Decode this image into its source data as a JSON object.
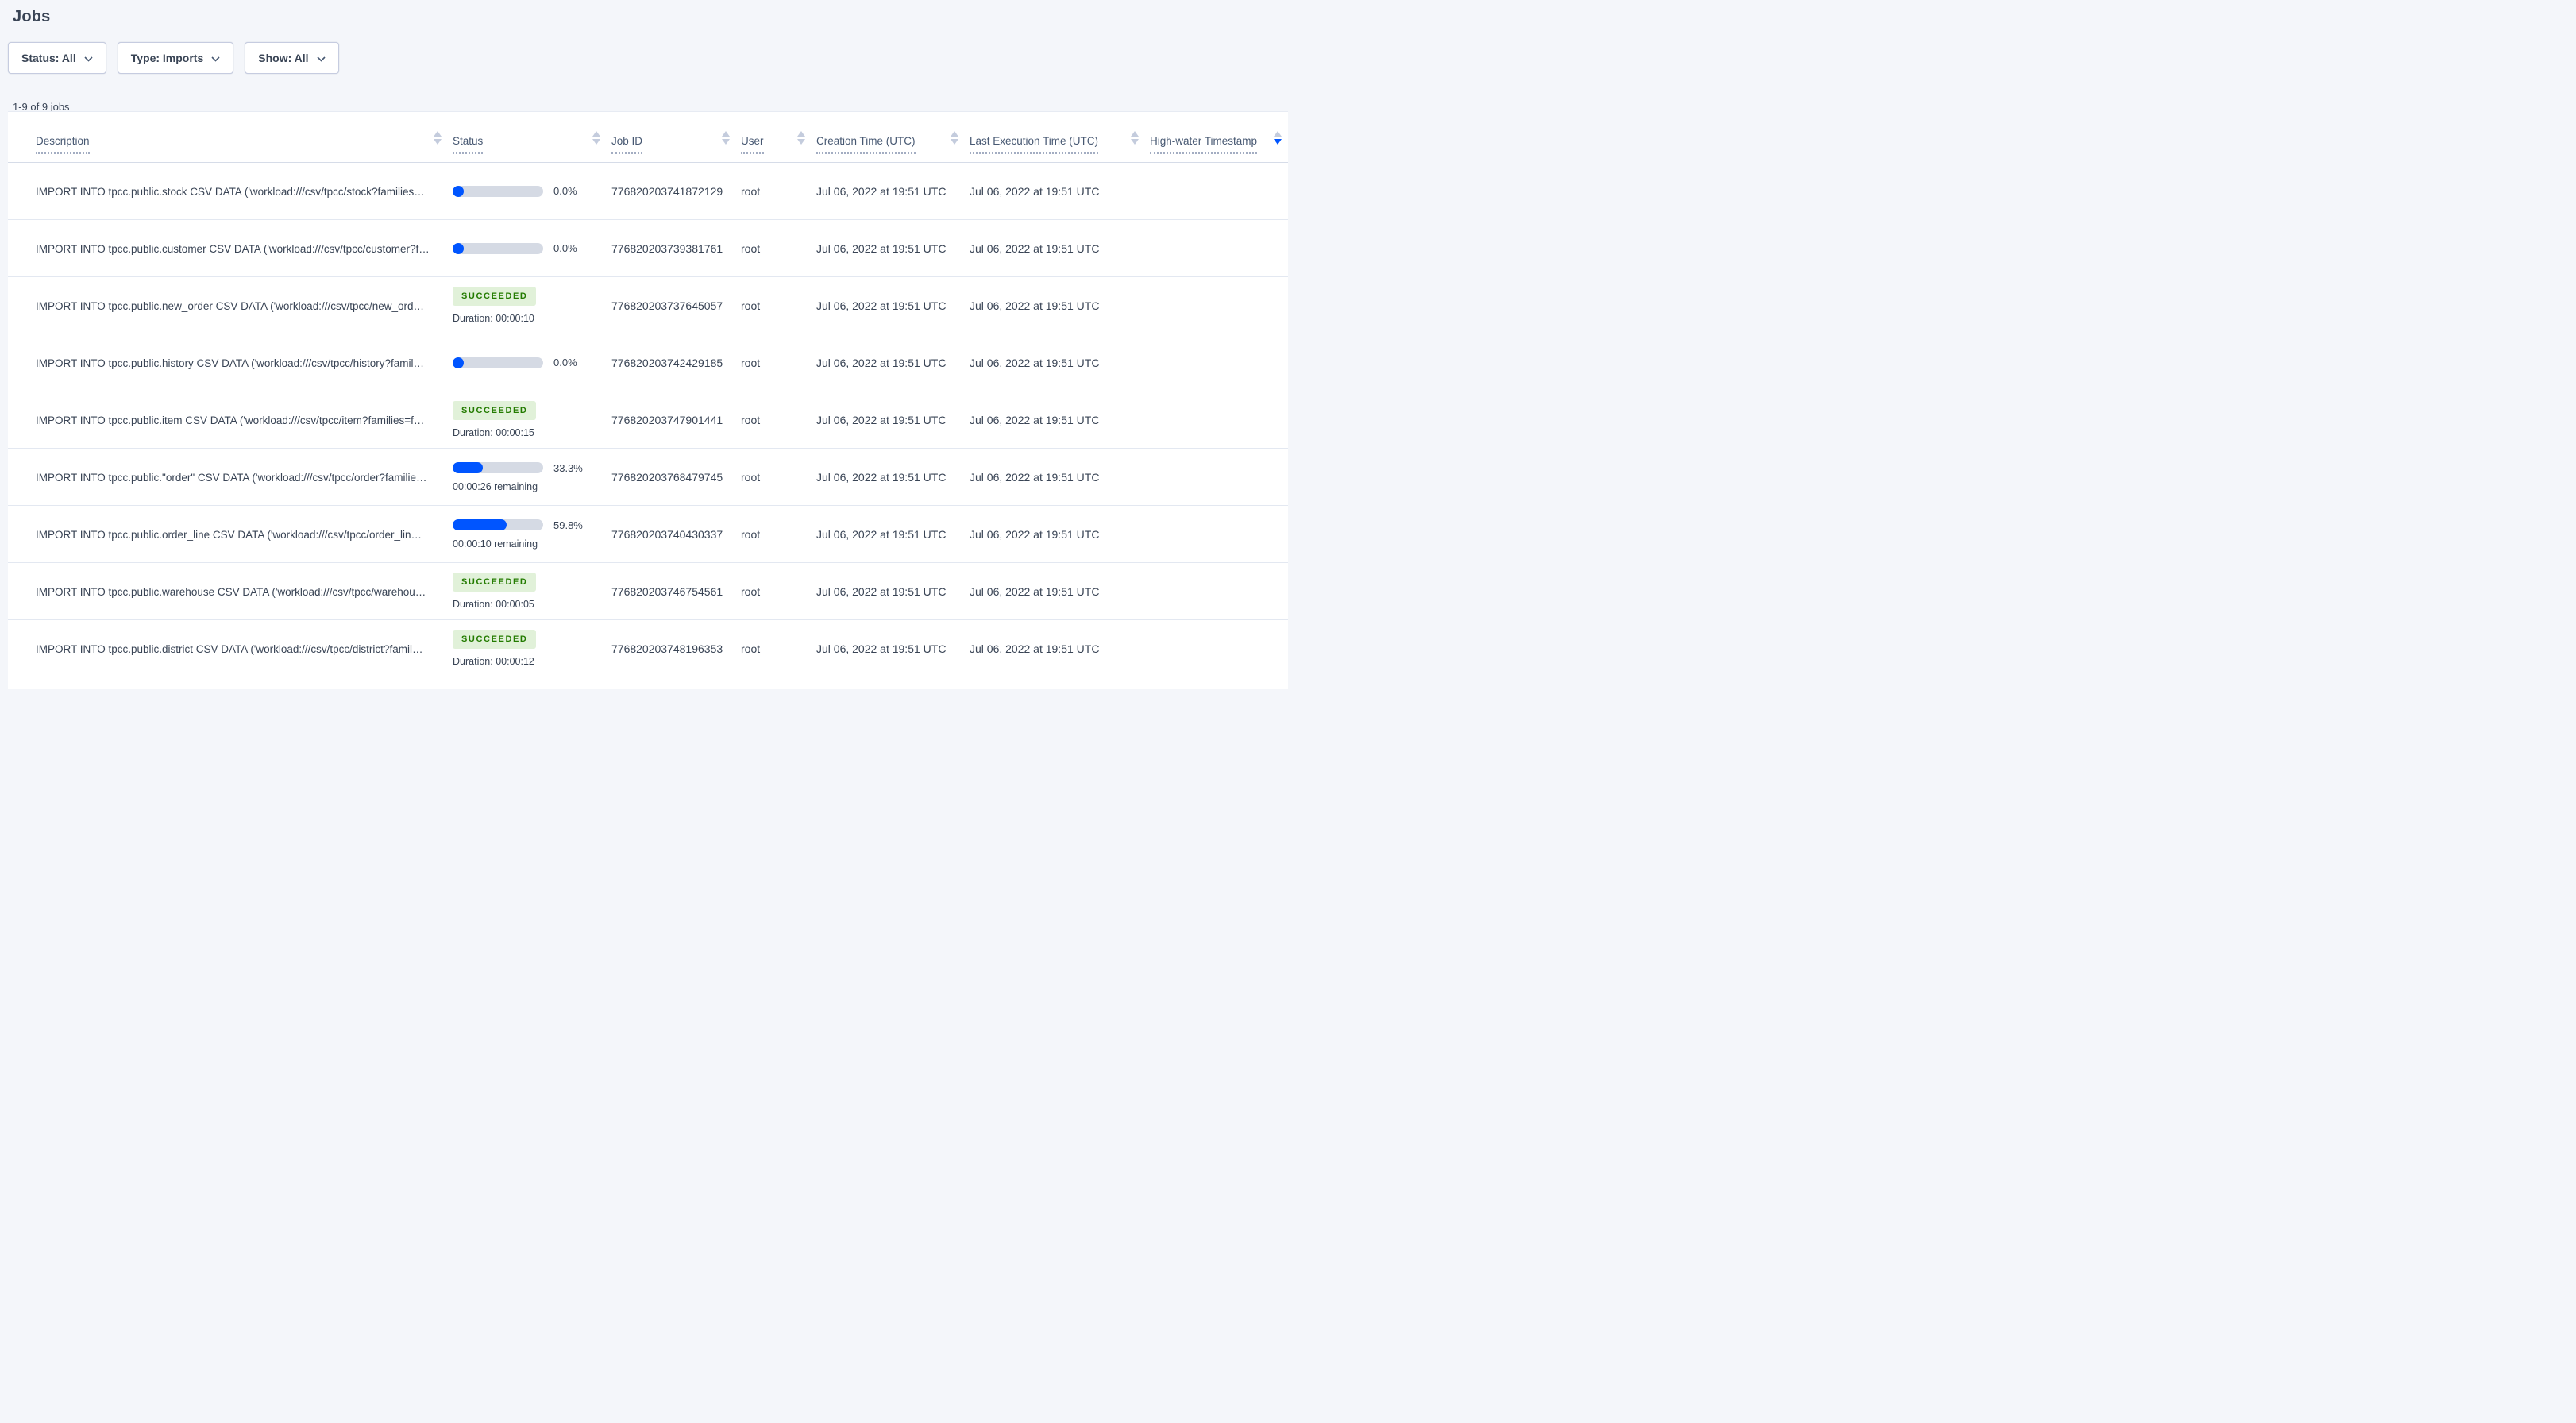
{
  "page": {
    "title": "Jobs",
    "results_count": "1-9 of 9 jobs"
  },
  "filters": [
    {
      "id": "status",
      "label": "Status: All"
    },
    {
      "id": "type",
      "label": "Type: Imports"
    },
    {
      "id": "show",
      "label": "Show: All"
    }
  ],
  "icons": {
    "chevron_down": "chevron-down",
    "sort_arrows": "sort-arrows"
  },
  "colors": {
    "accent_blue": "#0055ff",
    "progress_track": "#d5dae4",
    "badge_green_bg": "#e1f1d9",
    "badge_green_text": "#237b00",
    "page_background": "#f4f6fa",
    "text": "#394455"
  },
  "table": {
    "columns": [
      {
        "label": "Description",
        "sort": "none"
      },
      {
        "label": "Status",
        "sort": "none"
      },
      {
        "label": "Job ID",
        "sort": "none"
      },
      {
        "label": "User",
        "sort": "none"
      },
      {
        "label": "Creation Time (UTC)",
        "sort": "none"
      },
      {
        "label": "Last Execution Time (UTC)",
        "sort": "none"
      },
      {
        "label": "High-water Timestamp",
        "sort": "desc"
      }
    ],
    "rows": [
      {
        "description": "IMPORT INTO tpcc.public.stock CSV DATA ('workload:///csv/tpcc/stock?families…",
        "status": {
          "kind": "progress",
          "percent": "0.0%",
          "fraction": 0,
          "sub": ""
        },
        "job_id": "776820203741872129",
        "user": "root",
        "creation_time": "Jul 06, 2022 at 19:51 UTC",
        "last_execution_time": "Jul 06, 2022 at 19:51 UTC",
        "high_water_timestamp": ""
      },
      {
        "description": "IMPORT INTO tpcc.public.customer CSV DATA ('workload:///csv/tpcc/customer?f…",
        "status": {
          "kind": "progress",
          "percent": "0.0%",
          "fraction": 0,
          "sub": ""
        },
        "job_id": "776820203739381761",
        "user": "root",
        "creation_time": "Jul 06, 2022 at 19:51 UTC",
        "last_execution_time": "Jul 06, 2022 at 19:51 UTC",
        "high_water_timestamp": ""
      },
      {
        "description": "IMPORT INTO tpcc.public.new_order CSV DATA ('workload:///csv/tpcc/new_ord…",
        "status": {
          "kind": "succeeded",
          "label": "SUCCEEDED",
          "sub": "Duration: 00:00:10"
        },
        "job_id": "776820203737645057",
        "user": "root",
        "creation_time": "Jul 06, 2022 at 19:51 UTC",
        "last_execution_time": "Jul 06, 2022 at 19:51 UTC",
        "high_water_timestamp": ""
      },
      {
        "description": "IMPORT INTO tpcc.public.history CSV DATA ('workload:///csv/tpcc/history?famil…",
        "status": {
          "kind": "progress",
          "percent": "0.0%",
          "fraction": 0,
          "sub": ""
        },
        "job_id": "776820203742429185",
        "user": "root",
        "creation_time": "Jul 06, 2022 at 19:51 UTC",
        "last_execution_time": "Jul 06, 2022 at 19:51 UTC",
        "high_water_timestamp": ""
      },
      {
        "description": "IMPORT INTO tpcc.public.item CSV DATA ('workload:///csv/tpcc/item?families=f…",
        "status": {
          "kind": "succeeded",
          "label": "SUCCEEDED",
          "sub": "Duration: 00:00:15"
        },
        "job_id": "776820203747901441",
        "user": "root",
        "creation_time": "Jul 06, 2022 at 19:51 UTC",
        "last_execution_time": "Jul 06, 2022 at 19:51 UTC",
        "high_water_timestamp": ""
      },
      {
        "description": "IMPORT INTO tpcc.public.\"order\" CSV DATA ('workload:///csv/tpcc/order?familie…",
        "status": {
          "kind": "progress",
          "percent": "33.3%",
          "fraction": 0.333,
          "sub": "00:00:26 remaining"
        },
        "job_id": "776820203768479745",
        "user": "root",
        "creation_time": "Jul 06, 2022 at 19:51 UTC",
        "last_execution_time": "Jul 06, 2022 at 19:51 UTC",
        "high_water_timestamp": ""
      },
      {
        "description": "IMPORT INTO tpcc.public.order_line CSV DATA ('workload:///csv/tpcc/order_lin…",
        "status": {
          "kind": "progress",
          "percent": "59.8%",
          "fraction": 0.598,
          "sub": "00:00:10 remaining"
        },
        "job_id": "776820203740430337",
        "user": "root",
        "creation_time": "Jul 06, 2022 at 19:51 UTC",
        "last_execution_time": "Jul 06, 2022 at 19:51 UTC",
        "high_water_timestamp": ""
      },
      {
        "description": "IMPORT INTO tpcc.public.warehouse CSV DATA ('workload:///csv/tpcc/warehou…",
        "status": {
          "kind": "succeeded",
          "label": "SUCCEEDED",
          "sub": "Duration: 00:00:05"
        },
        "job_id": "776820203746754561",
        "user": "root",
        "creation_time": "Jul 06, 2022 at 19:51 UTC",
        "last_execution_time": "Jul 06, 2022 at 19:51 UTC",
        "high_water_timestamp": ""
      },
      {
        "description": "IMPORT INTO tpcc.public.district CSV DATA ('workload:///csv/tpcc/district?famil…",
        "status": {
          "kind": "succeeded",
          "label": "SUCCEEDED",
          "sub": "Duration: 00:00:12"
        },
        "job_id": "776820203748196353",
        "user": "root",
        "creation_time": "Jul 06, 2022 at 19:51 UTC",
        "last_execution_time": "Jul 06, 2022 at 19:51 UTC",
        "high_water_timestamp": ""
      }
    ]
  }
}
